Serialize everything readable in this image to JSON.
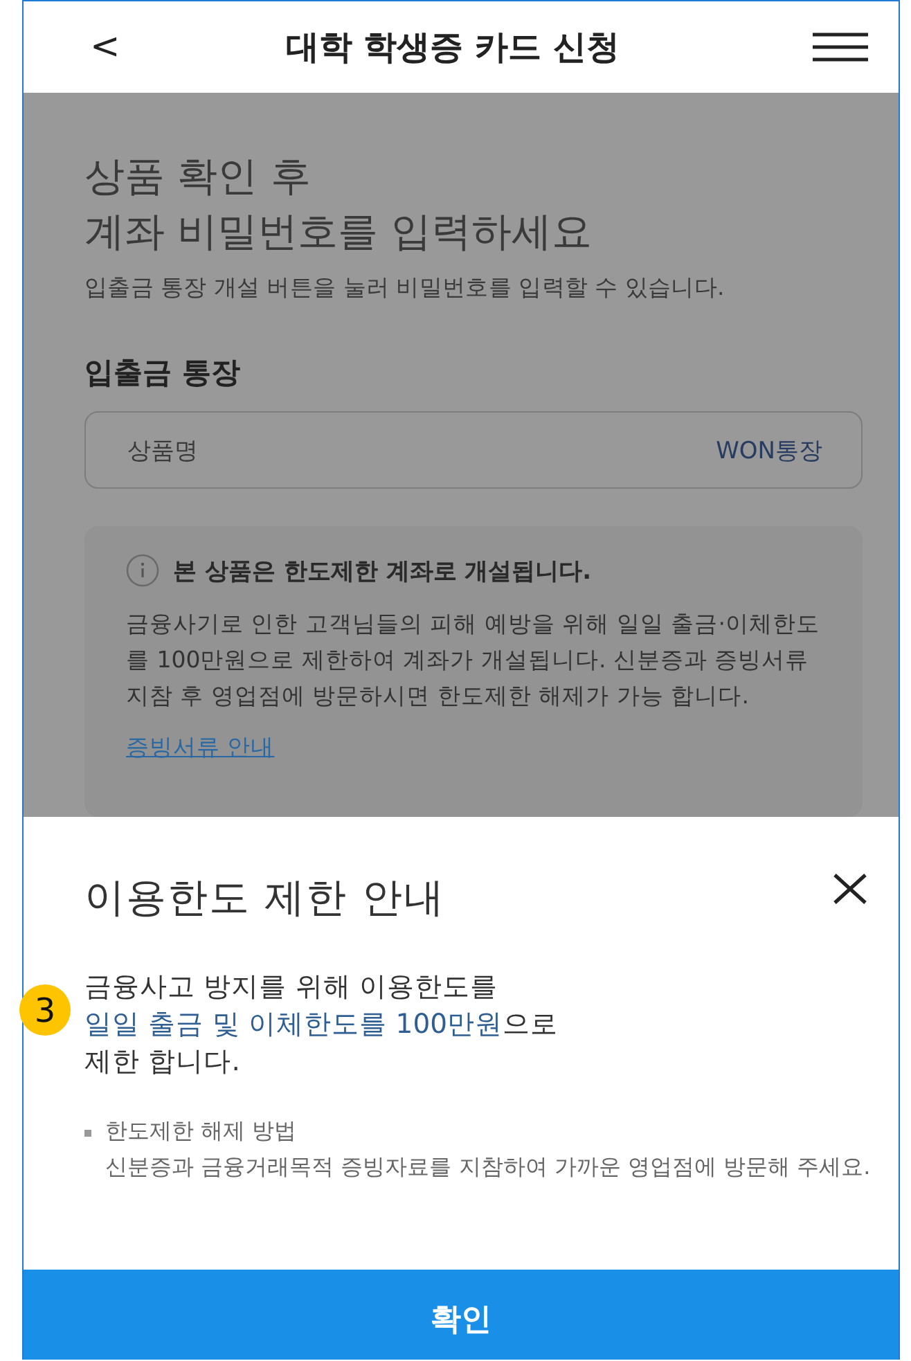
{
  "header": {
    "back_icon": "<",
    "title": "대학 학생증 카드 신청"
  },
  "page": {
    "heading": [
      "상품 확인 후",
      "계좌 비밀번호를 입력하세요"
    ],
    "subtitle": "입출금 통장 개설 버튼을 눌러 비밀번호를 입력할 수 있습니다.",
    "section_title": "입출금 통장",
    "product": {
      "label": "상품명",
      "value": "WON통장"
    },
    "notice": {
      "title": "본 상품은 한도제한 계좌로 개설됩니다.",
      "body": "금융사기로 인한 고객님들의 피해 예방을 위해 일일 출금·이체한도를 100만원으로 제한하여 계좌가 개설됩니다. 신분증과 증빙서류 지참 후 영업점에 방문하시면 한도제한 해제가 가능 합니다.",
      "link": "증빙서류 안내"
    }
  },
  "sheet": {
    "title": "이용한도 제한 안내",
    "message": [
      {
        "text": "금융사고 방지를 위해 이용한도를\n",
        "highlight": false
      },
      {
        "text": "일일 출금 및 이체한도를 100만원",
        "highlight": true
      },
      {
        "text": "으로\n제한 합니다.",
        "highlight": false
      }
    ],
    "bullet": {
      "title": "한도제한 해제 방법",
      "body": "신분증과 금융거래목적 증빙자료를 지참하여 가까운 영업점에 방문해 주세요."
    },
    "confirm_button": "확인"
  },
  "annotation": {
    "marker": "3"
  }
}
